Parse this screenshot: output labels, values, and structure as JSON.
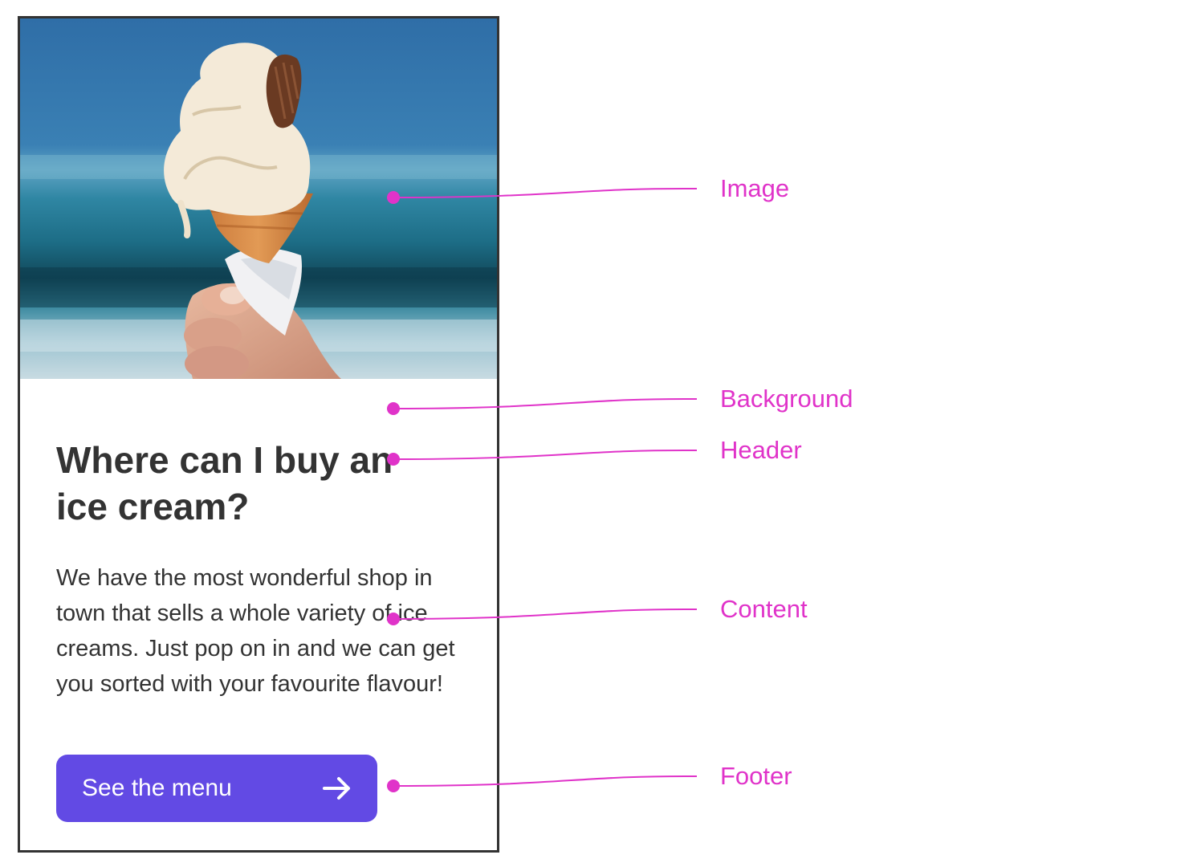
{
  "card": {
    "title": "Where can I buy an ice cream?",
    "body": "We have the most wonderful shop in town that sells a whole variety of ice creams. Just pop on in and we can get you sorted with your favourite flavour!",
    "button_label": "See the menu",
    "button_icon": "arrow-right-icon",
    "image": "ice-cream-cone-photo"
  },
  "annotations": {
    "image": "Image",
    "background": "Background",
    "header": "Header",
    "content": "Content",
    "footer": "Footer"
  },
  "colors": {
    "annotation": "#e033c9",
    "button": "#624ae4",
    "border": "#333333",
    "text": "#333333"
  }
}
